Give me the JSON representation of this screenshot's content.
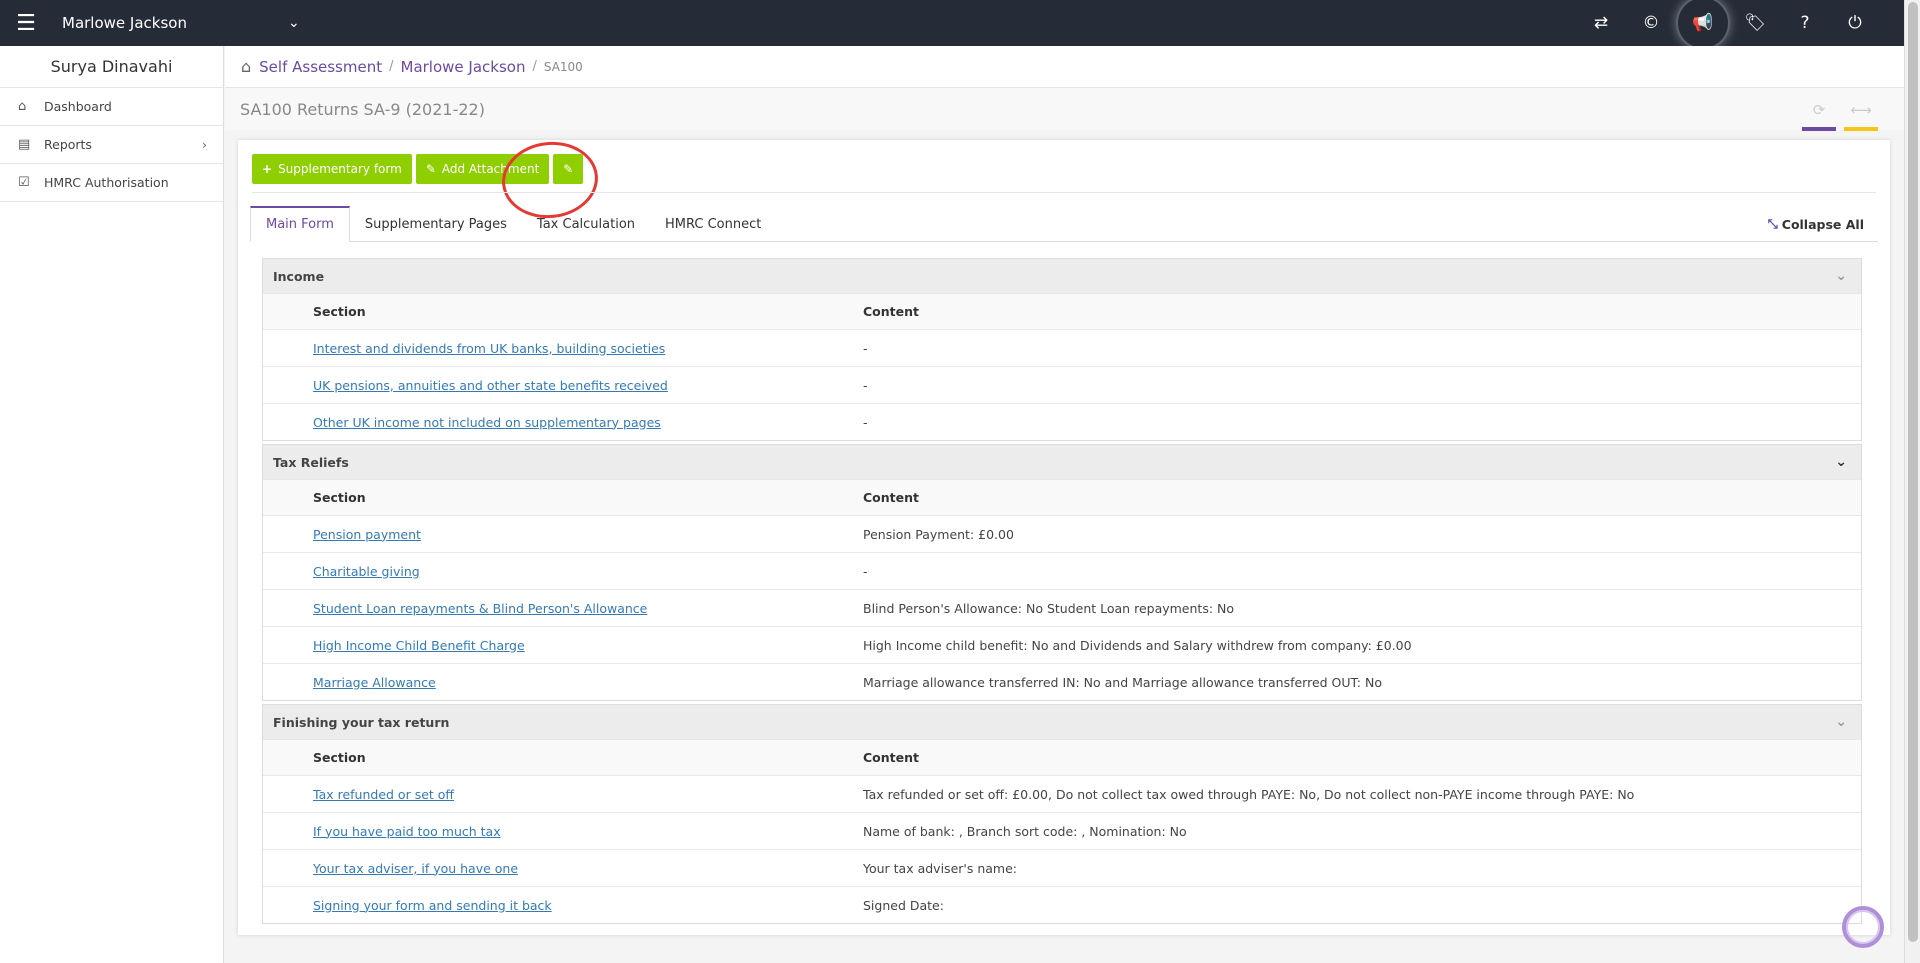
{
  "topbar": {
    "client_name": "Marlowe Jackson",
    "icons": [
      "menu-icon",
      "chevron-down-icon",
      "swap-icon",
      "copyright-icon",
      "megaphone-icon",
      "tag-icon",
      "help-icon",
      "power-icon"
    ]
  },
  "sidebar": {
    "user_name": "Surya Dinavahi",
    "items": [
      {
        "label": "Dashboard",
        "icon": "home-icon"
      },
      {
        "label": "Reports",
        "icon": "document-icon"
      },
      {
        "label": "HMRC Authorisation",
        "icon": "checkbox-icon"
      }
    ]
  },
  "breadcrumb": {
    "items": [
      "Self Assessment",
      "Marlowe Jackson"
    ],
    "current": "SA100"
  },
  "page": {
    "title": "SA100 Returns SA-9 (2021-22)",
    "accent_purple": "#6c4aa1",
    "accent_yellow": "#f5c518"
  },
  "toolbar": {
    "supplementary_label": "Supplementary form",
    "attachment_label": "Add Attachment",
    "button_color": "#8fce00"
  },
  "tabs": [
    "Main Form",
    "Supplementary Pages",
    "Tax Calculation",
    "HMRC Connect"
  ],
  "collapse_label": "Collapse All",
  "table_headers": {
    "section": "Section",
    "content": "Content"
  },
  "sections": [
    {
      "title": "Income",
      "rows": [
        {
          "section": "Interest and dividends from UK banks, building societies",
          "content": "-"
        },
        {
          "section": "UK pensions, annuities and other state benefits received",
          "content": "-"
        },
        {
          "section": "Other UK income not included on supplementary pages",
          "content": "-"
        }
      ]
    },
    {
      "title": "Tax Reliefs",
      "rows": [
        {
          "section": "Pension payment",
          "content": "Pension Payment: £0.00"
        },
        {
          "section": "Charitable giving",
          "content": "-"
        },
        {
          "section": "Student Loan repayments & Blind Person's Allowance",
          "content": "Blind Person's Allowance: No Student Loan repayments: No"
        },
        {
          "section": "High Income Child Benefit Charge",
          "content": "High Income child benefit: No and Dividends and Salary withdrew from company: £0.00"
        },
        {
          "section": "Marriage Allowance",
          "content": "Marriage allowance transferred IN: No and Marriage allowance transferred OUT: No"
        }
      ]
    },
    {
      "title": "Finishing your tax return",
      "rows": [
        {
          "section": "Tax refunded or set off",
          "content": "Tax refunded or set off: £0.00, Do not collect tax owed through PAYE: No, Do not collect non-PAYE income through PAYE: No"
        },
        {
          "section": "If you have paid too much tax",
          "content": "Name of bank: , Branch sort code: , Nomination: No"
        },
        {
          "section": "Your tax adviser, if you have one",
          "content": "Your tax adviser's name:"
        },
        {
          "section": "Signing your form and sending it back",
          "content": "Signed Date:"
        }
      ]
    }
  ]
}
